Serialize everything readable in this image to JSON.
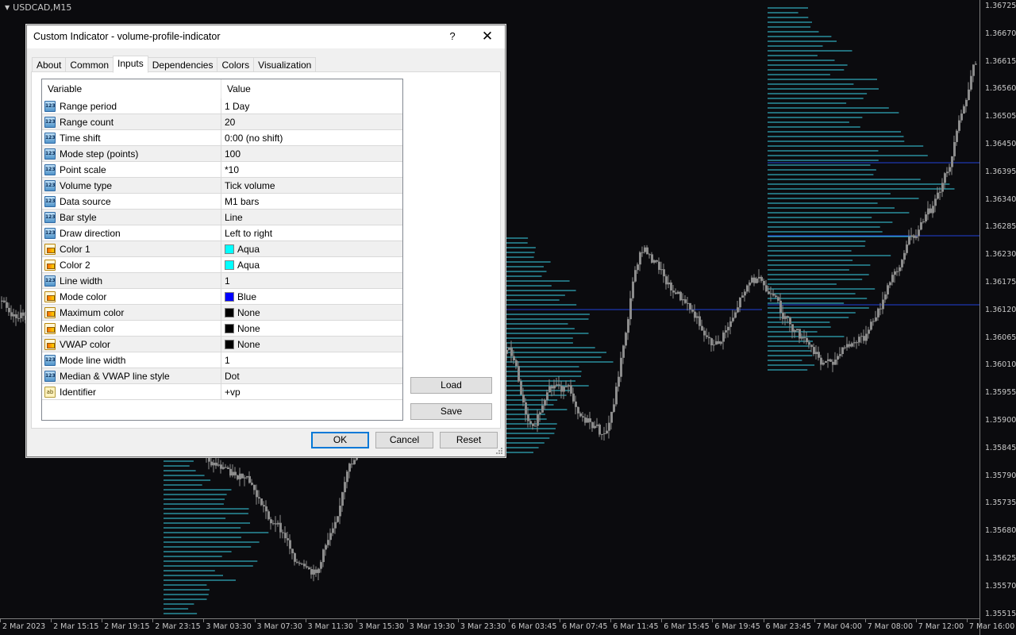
{
  "chart": {
    "symbol": "USDCAD,M15",
    "colors": {
      "background": "#0b0b0e",
      "candles": "#8c8c8c",
      "profile": "#38d0e6",
      "mode_line": "#2040d8"
    },
    "price_labels": [
      "1.36725",
      "1.36670",
      "1.36615",
      "1.36560",
      "1.36505",
      "1.36450",
      "1.36395",
      "1.36340",
      "1.36285",
      "1.36230",
      "1.36175",
      "1.36120",
      "1.36065",
      "1.36010",
      "1.35955",
      "1.35900",
      "1.35845",
      "1.35790",
      "1.35735",
      "1.35680",
      "1.35625",
      "1.35570",
      "1.35515"
    ],
    "time_labels": [
      "2 Mar 2023",
      "2 Mar 15:15",
      "2 Mar 19:15",
      "2 Mar 23:15",
      "3 Mar 03:30",
      "3 Mar 07:30",
      "3 Mar 11:30",
      "3 Mar 15:30",
      "3 Mar 19:30",
      "3 Mar 23:30",
      "6 Mar 03:45",
      "6 Mar 07:45",
      "6 Mar 11:45",
      "6 Mar 15:45",
      "6 Mar 19:45",
      "6 Mar 23:45",
      "7 Mar 04:00",
      "7 Mar 08:00",
      "7 Mar 12:00",
      "7 Mar 16:00"
    ]
  },
  "dialog": {
    "title": "Custom Indicator - volume-profile-indicator",
    "help": "?",
    "close": "✕",
    "tabs": [
      {
        "label": "About"
      },
      {
        "label": "Common"
      },
      {
        "label": "Inputs",
        "active": true
      },
      {
        "label": "Dependencies"
      },
      {
        "label": "Colors"
      },
      {
        "label": "Visualization"
      }
    ],
    "table": {
      "headers": {
        "variable": "Variable",
        "value": "Value"
      },
      "rows": [
        {
          "icon": "num",
          "variable": "Range period",
          "value": "1 Day"
        },
        {
          "icon": "num",
          "variable": "Range count",
          "value": "20"
        },
        {
          "icon": "num",
          "variable": "Time shift",
          "value": "0:00 (no shift)"
        },
        {
          "icon": "num",
          "variable": "Mode step (points)",
          "value": "100"
        },
        {
          "icon": "num",
          "variable": "Point scale",
          "value": "*10"
        },
        {
          "icon": "num",
          "variable": "Volume type",
          "value": "Tick volume"
        },
        {
          "icon": "num",
          "variable": "Data source",
          "value": "M1 bars"
        },
        {
          "icon": "num",
          "variable": "Bar style",
          "value": "Line"
        },
        {
          "icon": "num",
          "variable": "Draw direction",
          "value": "Left to right"
        },
        {
          "icon": "col",
          "variable": "Color 1",
          "value": "Aqua",
          "swatch": "#00ffff"
        },
        {
          "icon": "col",
          "variable": "Color 2",
          "value": "Aqua",
          "swatch": "#00ffff"
        },
        {
          "icon": "num",
          "variable": "Line width",
          "value": "1"
        },
        {
          "icon": "col",
          "variable": "Mode color",
          "value": "Blue",
          "swatch": "#0000ff"
        },
        {
          "icon": "col",
          "variable": "Maximum color",
          "value": "None",
          "swatch": "#000000"
        },
        {
          "icon": "col",
          "variable": "Median color",
          "value": "None",
          "swatch": "#000000"
        },
        {
          "icon": "col",
          "variable": "VWAP color",
          "value": "None",
          "swatch": "#000000"
        },
        {
          "icon": "num",
          "variable": "Mode line width",
          "value": "1"
        },
        {
          "icon": "num",
          "variable": "Median & VWAP line style",
          "value": "Dot"
        },
        {
          "icon": "str",
          "variable": "Identifier",
          "value": "+vp"
        }
      ]
    },
    "icon_text": {
      "num": "123",
      "str": "ab"
    },
    "buttons": {
      "load": "Load",
      "save": "Save",
      "ok": "OK",
      "cancel": "Cancel",
      "reset": "Reset"
    }
  }
}
